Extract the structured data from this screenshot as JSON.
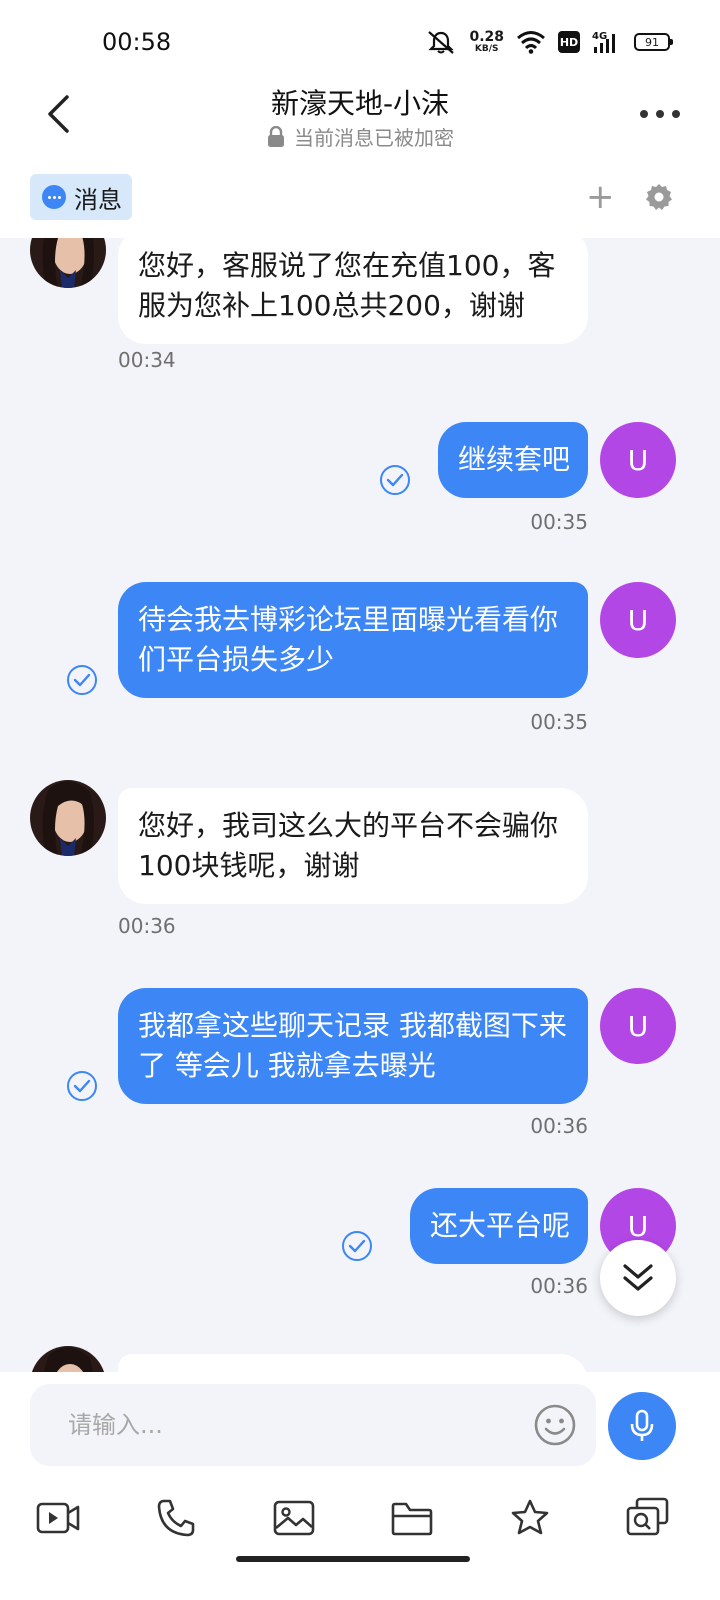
{
  "status_bar": {
    "time": "00:58",
    "net_speed": "0.28",
    "net_unit": "KB/S",
    "hd": "HD",
    "network": "4G",
    "battery": "91",
    "icons": [
      "mute-icon",
      "wifi-icon",
      "signal-icon",
      "battery-icon"
    ]
  },
  "header": {
    "title": "新濠天地-小沫",
    "subtitle": "当前消息已被加密"
  },
  "tabs": {
    "messages_label": "消息",
    "add_symbol": "+"
  },
  "messages": [
    {
      "side": "in",
      "text": "您好，客服说了您在充值100，客服为您补上100总共200，谢谢",
      "time": "00:34"
    },
    {
      "side": "out",
      "avatar": "U",
      "text": "继续套吧",
      "time": "00:35",
      "read": true
    },
    {
      "side": "out",
      "avatar": "U",
      "text": "待会我去博彩论坛里面曝光看看你们平台损失多少",
      "time": "00:35",
      "read": true
    },
    {
      "side": "in",
      "text": "您好，我司这么大的平台不会骗你100块钱呢，谢谢",
      "time": "00:36"
    },
    {
      "side": "out",
      "avatar": "U",
      "text": "我都拿这些聊天记录 我都截图下来了 等会儿 我就拿去曝光",
      "time": "00:36",
      "read": true
    },
    {
      "side": "out",
      "avatar": "U",
      "text": "还大平台呢",
      "time": "00:36",
      "read": true
    }
  ],
  "input": {
    "placeholder": "请输入..."
  },
  "colors": {
    "accent": "#3c86f5",
    "user_avatar": "#b347e6",
    "chat_background": "#f2f4f9",
    "tab_highlight": "#d7e8fb"
  },
  "toolbar": [
    "video-icon",
    "phone-icon",
    "image-icon",
    "folder-icon",
    "star-icon",
    "search-card-icon"
  ]
}
